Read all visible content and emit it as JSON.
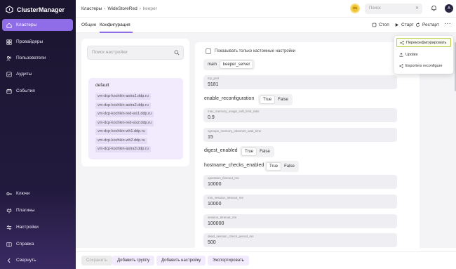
{
  "app": {
    "name": "ClusterManager"
  },
  "sidebar": {
    "items": [
      {
        "label": "Кластеры",
        "icon": "home-icon",
        "active": true
      },
      {
        "label": "Провайдеры",
        "icon": "grid-icon"
      },
      {
        "label": "Пользователи",
        "icon": "users-icon"
      },
      {
        "label": "Аудиты",
        "icon": "check-square-icon"
      },
      {
        "label": "События",
        "icon": "calendar-icon"
      }
    ],
    "bottom_items": [
      {
        "label": "Ключи",
        "icon": "key-icon"
      },
      {
        "label": "Плагины",
        "icon": "plugin-icon"
      },
      {
        "label": "Настройки",
        "icon": "sliders-icon"
      },
      {
        "label": "Справка",
        "icon": "book-icon"
      },
      {
        "label": "Свернуть",
        "icon": "chevron-left-icon"
      }
    ],
    "accent": "#8f6ce8"
  },
  "header": {
    "breadcrumb": [
      "Кластеры",
      "WideStoreRed",
      "keeper"
    ],
    "user_badge": "ОБ",
    "search_placeholder": "Поиск",
    "avatar": "A"
  },
  "tabs": {
    "items": [
      "Общие",
      "Конфигурация"
    ],
    "active": "Конфигурация"
  },
  "actions": {
    "stop": "Стоп",
    "start": "Старт",
    "restart": "Рестарт",
    "more": "···"
  },
  "dropdown": {
    "items": [
      {
        "label": "Переконфигурировать",
        "icon": "share-icon",
        "highlighted": true
      },
      {
        "label": "Update",
        "icon": "upload-icon"
      },
      {
        "label": "Exporters reconfigure",
        "icon": "share-icon"
      }
    ]
  },
  "left_panel": {
    "search_placeholder": "Поиск настройки",
    "group": {
      "title": "default",
      "hosts": [
        "vm-dcp-kochkin-astra1.ddp.ru",
        "vm-dcp-kochkin-astra2.ddp.ru",
        "vm-dcp-kochkin-red-ws1.ddp.ru",
        "vm-dcp-kochkin-red-ws2.ddp.ru",
        "vm-dcp-kochkin-wh1.ddp.ru",
        "vm-dcp-kochkin-wh2.ddp.ru",
        "vm-dcp-kochkin-astra3.ddp.ru"
      ]
    }
  },
  "config": {
    "custom_only_label": "Показывать только кастомные настройки",
    "sections": [
      "main",
      "keeper_server"
    ],
    "active_section": "keeper_server",
    "tcp_port": {
      "label": "tcp_port",
      "value": "9181"
    },
    "enable_reconfiguration": {
      "label": "enable_reconfiguration",
      "value": "True"
    },
    "max_memory_usage_soft_limit_ratio": {
      "label": "max_memory_usage_soft_limit_ratio",
      "value": "0.9"
    },
    "cgroups_memory_observer_wait_time": {
      "label": "cgroups_memory_observer_wait_time",
      "value": "15"
    },
    "digest_enabled": {
      "label": "digest_enabled",
      "value": "True"
    },
    "hostname_checks_enabled": {
      "label": "hostname_checks_enabled",
      "value": "True"
    },
    "operation_timeout_ms": {
      "label": "operation_timeout_ms",
      "value": "10000"
    },
    "min_session_timeout_ms": {
      "label": "min_session_timeout_ms",
      "value": "10000"
    },
    "session_timeout_ms": {
      "label": "session_timeout_ms",
      "value": "100000"
    },
    "dead_session_check_period_ms": {
      "label": "dead_session_check_period_ms",
      "value": "500"
    },
    "true_label": "True",
    "false_label": "False"
  },
  "bottom": {
    "save": "Сохранить",
    "add_group": "Добавить группу",
    "add_setting": "Добавить настройку",
    "export": "Экспортировать"
  }
}
